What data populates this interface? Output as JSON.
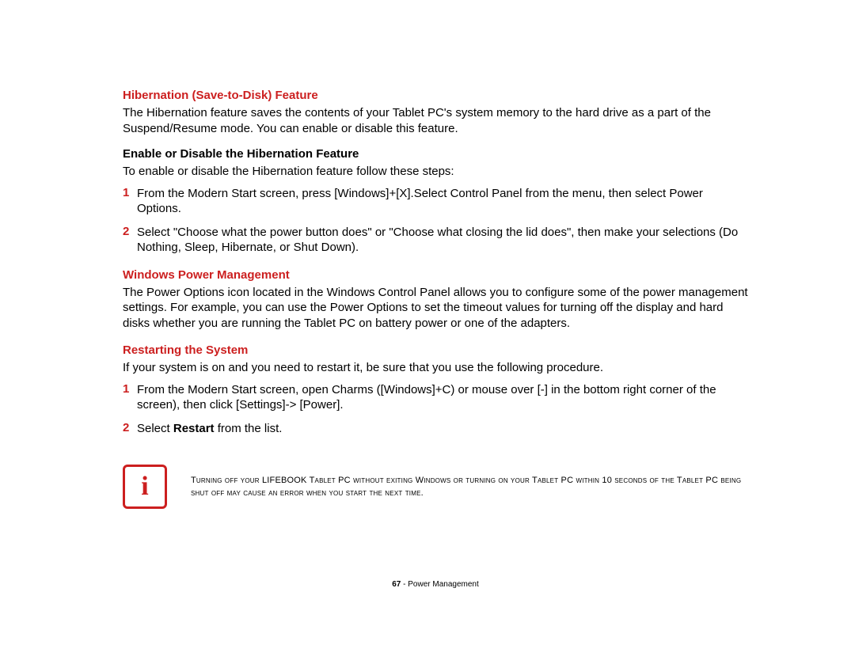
{
  "s1": {
    "heading": "Hibernation (Save-to-Disk) Feature",
    "body": "The Hibernation feature saves the contents of your Tablet PC's system memory to the hard drive as a part of the Suspend/Resume mode. You can enable or disable this feature."
  },
  "s2": {
    "heading": "Enable or Disable the Hibernation Feature",
    "intro": "To enable or disable the Hibernation feature follow these steps:",
    "items": [
      {
        "n": "1",
        "t": "From the Modern Start screen, press [Windows]+[X].Select Control Panel from the menu, then select Power Options."
      },
      {
        "n": "2",
        "t": "Select \"Choose what the power button does\" or \"Choose what closing the lid does\", then make your selections (Do Nothing, Sleep, Hibernate, or Shut Down)."
      }
    ]
  },
  "s3": {
    "heading": "Windows Power Management",
    "body": "The Power Options icon located in the Windows Control Panel allows you to configure some of the power management settings. For example, you can use the Power Options to set the timeout values for turning off the display and hard disks whether you are running the Tablet PC on battery power or one of the adapters."
  },
  "s4": {
    "heading": "Restarting the System",
    "intro": "If your system is on and you need to restart it, be sure that you use the following procedure.",
    "items": [
      {
        "n": "1",
        "t": "From the Modern Start screen, open Charms ([Windows]+C) or mouse over [-] in the bottom right corner of the screen), then click [Settings]-> [Power]."
      },
      {
        "n": "2",
        "pre": "Select ",
        "bold": "Restart",
        "post": " from the list."
      }
    ]
  },
  "note": {
    "icon": "i",
    "text": "Turning off your LIFEBOOK Tablet PC without exiting Windows or turning on your Tablet PC within 10 seconds of the Tablet PC being shut off may cause an error when you start the next time."
  },
  "footer": {
    "page": "67",
    "sep": " - ",
    "title": "Power Management"
  }
}
